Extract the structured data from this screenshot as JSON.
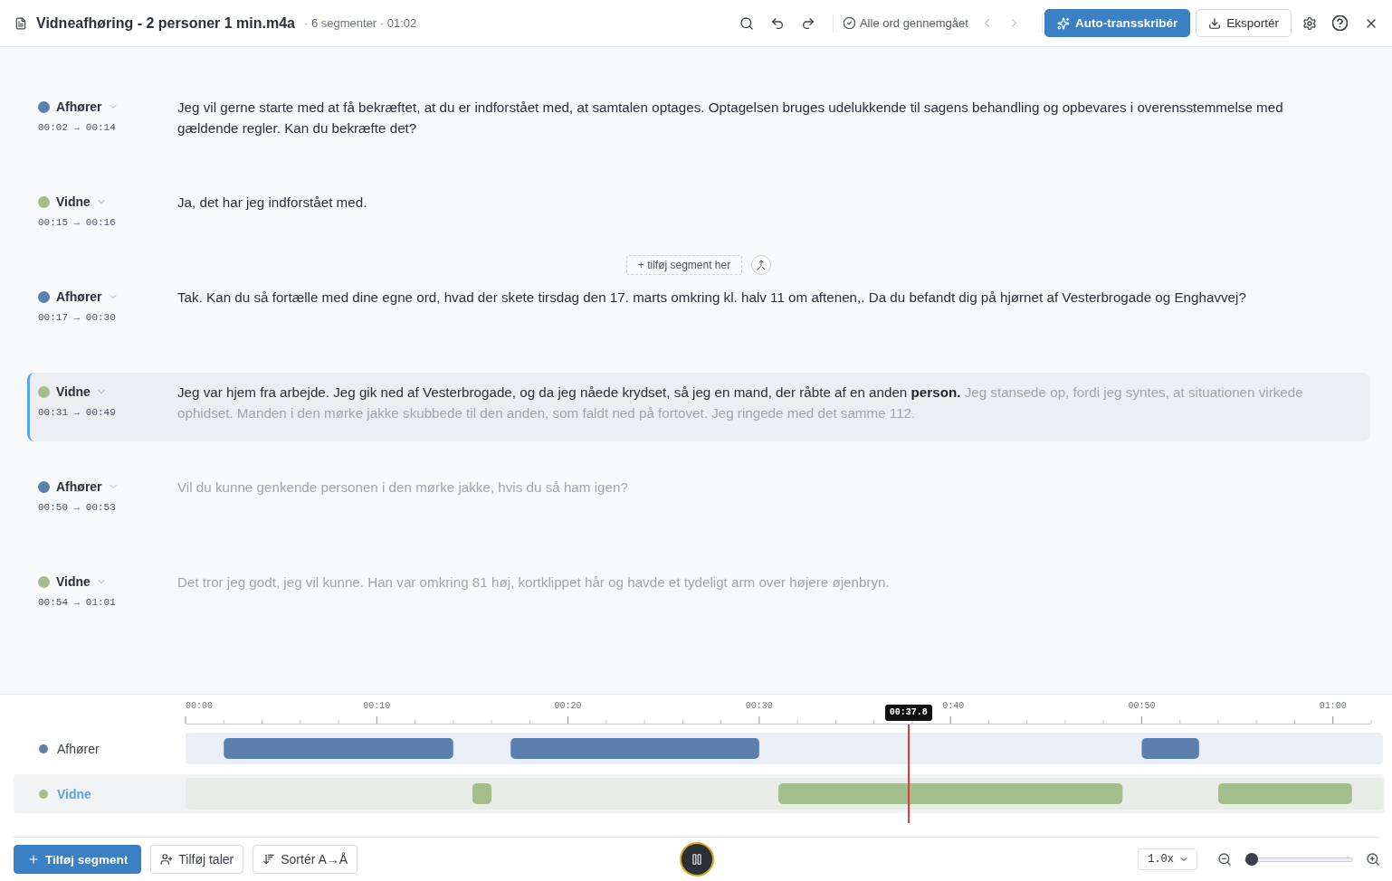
{
  "header": {
    "title": "Vidneafhøring - 2 personer 1 min.m4a",
    "meta": "· 6 segmenter · 01:02",
    "review_status": "Alle ord gennemgået",
    "nav_prev": {
      "disabled": true
    },
    "nav_next": {
      "disabled": true
    },
    "buttons": [
      {
        "kind": "primary",
        "label": "Auto-transskribér"
      },
      {
        "kind": "outline",
        "label": "Eksportér"
      }
    ]
  },
  "segments": [
    {
      "speaker": "Afhører",
      "color": "#5b7fae",
      "time": "00:02 → 00:14",
      "selected": false,
      "played": "Jeg vil gerne starte med at få bekræftet, at du er indforstået med, at samtalen optages. Optagelsen bruges udelukkende til sagens behandling og opbevares i overensstemmelse med gældende regler. Kan du bekræfte det?"
    },
    {
      "speaker": "Vidne",
      "color": "#a3be8c",
      "time": "00:15 → 00:16",
      "selected": false,
      "played": "Ja, det har jeg indforstået med.",
      "insert_hint": "+ tilføj segment her"
    },
    {
      "speaker": "Afhører",
      "color": "#5b7fae",
      "time": "00:17 → 00:30",
      "selected": false,
      "played": "Tak. Kan du så fortælle med dine egne ord, hvad der skete tirsdag den 17. marts omkring kl. halv 11 om aftenen,. Da du befandt dig på hjørnet af Vesterbrogade og Enghavvej?"
    },
    {
      "speaker": "Vidne",
      "color": "#a3be8c",
      "time": "00:31 → 00:49",
      "selected": true,
      "played": "Jeg var hjem fra arbejde. Jeg gik ned af Vesterbrogade, og da jeg nåede krydset, så jeg en mand, der råbte af en anden",
      "current_word": "person.",
      "pending": "Jeg stansede op, fordi jeg syntes, at situationen virkede ophidset. Manden i den mørke jakke skubbede til den anden, som faldt ned på fortovet. Jeg ringede med det samme 112."
    },
    {
      "speaker": "Afhører",
      "color": "#5b7fae",
      "time": "00:50 → 00:53",
      "selected": false,
      "pending": "Vil du kunne genkende personen i den mørke jakke, hvis du så ham igen?"
    },
    {
      "speaker": "Vidne",
      "color": "#a3be8c",
      "time": "00:54 → 01:01",
      "selected": false,
      "pending": "Det tror jeg godt, jeg vil kunne. Han var omkring 81 høj, kortklippet hår og havde et tydeligt arm over højere øjenbryn."
    }
  ],
  "timeline": {
    "ticks": [
      "00:00",
      "00:10",
      "00:20",
      "00:30",
      "0:40",
      "00:50",
      "01:00"
    ],
    "playhead": "00:37.8",
    "tracks": [
      {
        "label": "Afhører",
        "color": "#5b7fae",
        "selected": false
      },
      {
        "label": "Vidne",
        "color": "#a3be8c",
        "selected": true
      }
    ]
  },
  "footer": {
    "buttons": [
      {
        "kind": "primary",
        "label": "Tilføj segment"
      },
      {
        "kind": "outline",
        "label": "Tilføj taler"
      },
      {
        "kind": "outline",
        "label": "Sortér A→Å"
      }
    ],
    "playing": true,
    "speed": "1.0x",
    "zoom": {
      "level": 0
    }
  }
}
